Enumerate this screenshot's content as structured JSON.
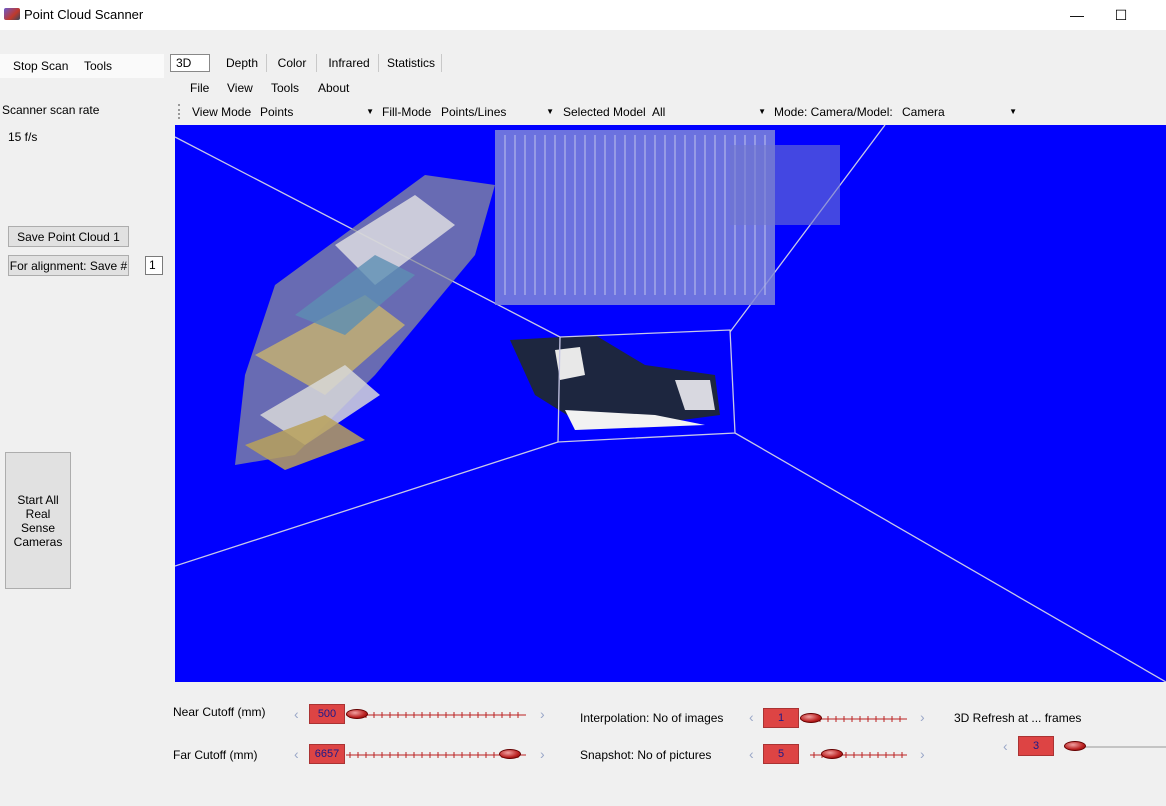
{
  "window": {
    "title": "Point Cloud Scanner",
    "minimize": "—",
    "maximize": "☐"
  },
  "left_menu": {
    "stop_scan": "Stop Scan",
    "tools": "Tools"
  },
  "left_panel": {
    "scan_rate_label": "Scanner scan rate",
    "scan_rate_value": "15 f/s",
    "save_point_cloud": "Save Point Cloud 1",
    "alignment_save": "For alignment: Save #",
    "alignment_value": "1",
    "start_cameras": "Start All Real Sense Cameras"
  },
  "tabs": [
    "3D",
    "Depth",
    "Color",
    "Infrared",
    "Statistics"
  ],
  "active_tab": "3D",
  "menu": {
    "file": "File",
    "view": "View",
    "tools": "Tools",
    "about": "About"
  },
  "toolbar": {
    "view_mode_label": "View Mode",
    "view_mode_value": "Points",
    "fill_mode_label": "Fill-Mode",
    "fill_mode_value": "Points/Lines",
    "selected_model_label": "Selected Model",
    "selected_model_value": "All",
    "mode_label": "Mode: Camera/Model:",
    "mode_value": "Camera"
  },
  "sliders": {
    "near_cutoff": {
      "label": "Near Cutoff (mm)",
      "value": "500",
      "fraction": 0.0
    },
    "far_cutoff": {
      "label": "Far Cutoff (mm)",
      "value": "6657",
      "fraction": 0.97
    },
    "interpolation": {
      "label": "Interpolation: No of images",
      "value": "1",
      "fraction": 0.0
    },
    "snapshot": {
      "label": "Snapshot: No of pictures",
      "value": "5",
      "fraction": 0.15
    },
    "refresh": {
      "label": "3D Refresh at ... frames",
      "value": "3",
      "fraction": 0.0
    }
  },
  "colors": {
    "viewport": "#0000ff",
    "value_box": "#dd4444",
    "value_text": "#1a1a8c"
  },
  "icons": {
    "left_arrow": "‹",
    "right_arrow": "›"
  }
}
